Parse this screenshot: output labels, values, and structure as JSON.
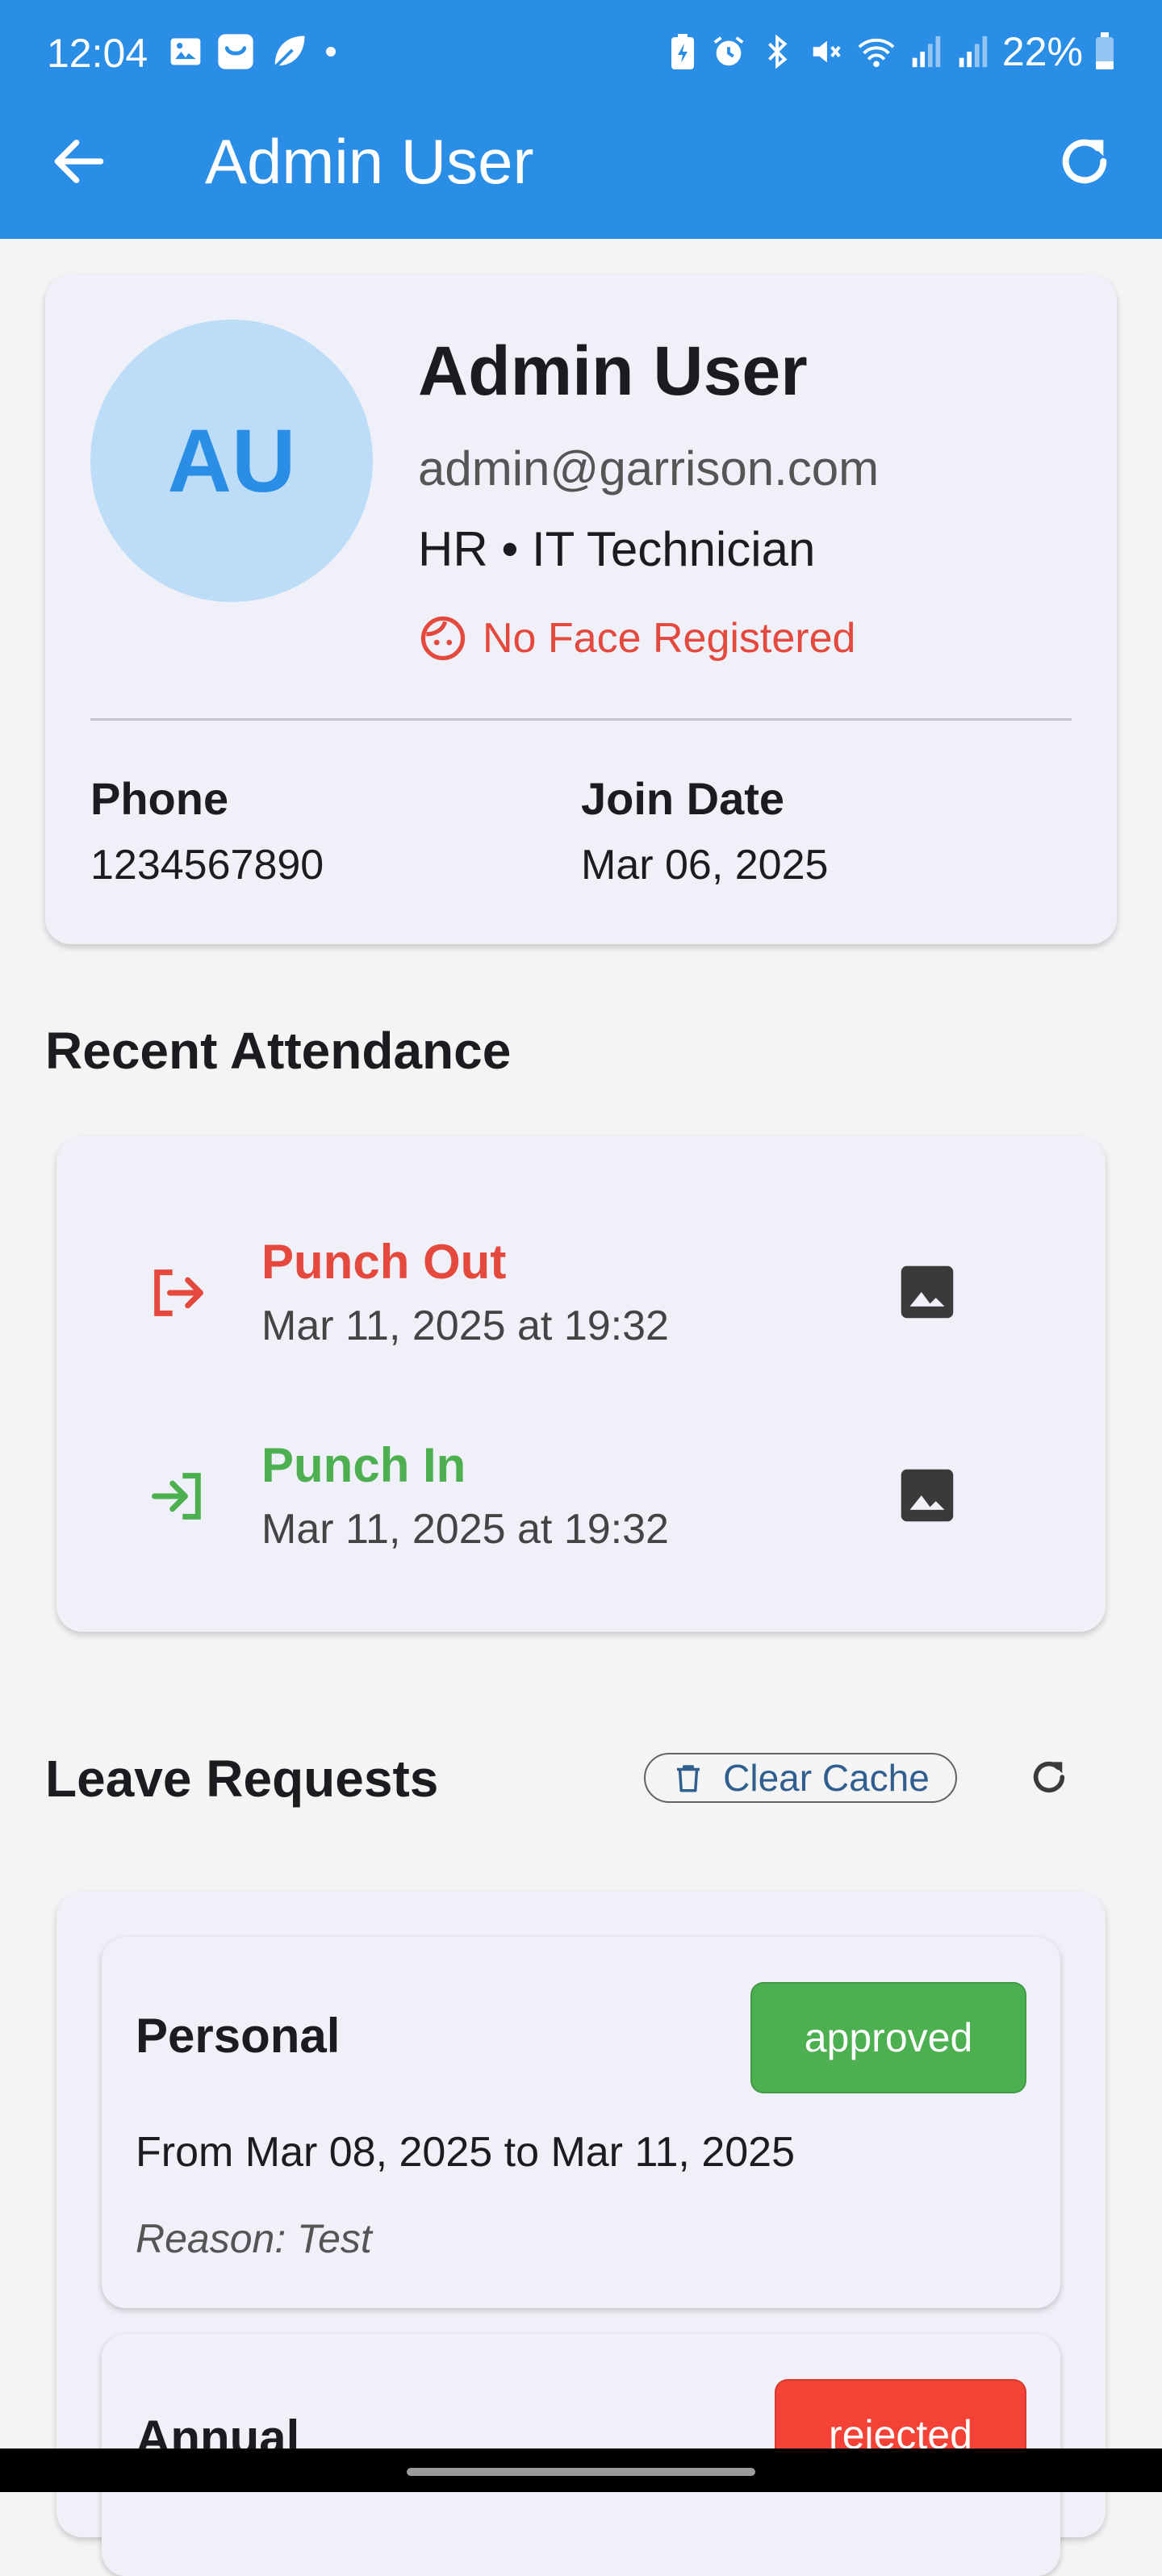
{
  "status_bar": {
    "time": "12:04",
    "battery": "22%"
  },
  "app_bar": {
    "title": "Admin User"
  },
  "profile": {
    "initials": "AU",
    "name": "Admin User",
    "email": "admin@garrison.com",
    "department_role": "HR • IT Technician",
    "face_status": "No Face Registered",
    "phone_label": "Phone",
    "phone": "1234567890",
    "join_label": "Join Date",
    "join_date": "Mar 06, 2025"
  },
  "attendance": {
    "title": "Recent Attendance",
    "items": [
      {
        "type": "Punch Out",
        "time": "Mar 11, 2025 at 19:32",
        "color": "#e5483c"
      },
      {
        "type": "Punch In",
        "time": "Mar 11, 2025 at 19:32",
        "color": "#4caf50"
      }
    ]
  },
  "leave": {
    "title": "Leave Requests",
    "clear_cache_label": "Clear Cache",
    "items": [
      {
        "type": "Personal",
        "status": "approved",
        "dates": "From Mar 08, 2025 to Mar 11, 2025",
        "reason": "Reason: Test",
        "status_color": "#4caf50"
      },
      {
        "type": "Annual",
        "status": "rejected",
        "status_color": "#f44336"
      }
    ]
  },
  "colors": {
    "primary": "#2a8de6",
    "approved": "#4caf50",
    "rejected": "#f44336",
    "face_warning": "#e5483c"
  }
}
